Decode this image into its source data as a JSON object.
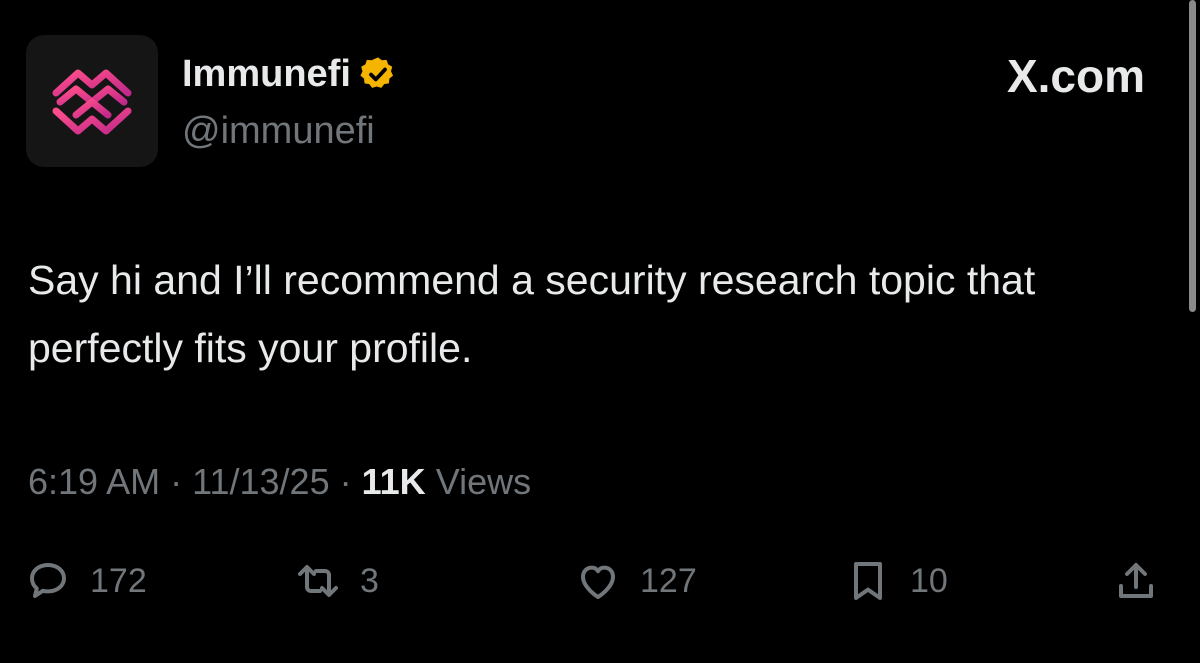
{
  "author": {
    "display_name": "Immunefi",
    "handle": "@immunefi",
    "avatar_icon": "immunefi-logo-icon",
    "verified_icon": "verified-badge-icon",
    "verified_color": "#f4b400"
  },
  "site_label": "X.com",
  "tweet": {
    "text": "Say hi and I’ll recommend a security research topic that perfectly fits your profile."
  },
  "meta": {
    "time": "6:19 AM",
    "separator": "·",
    "date": "11/13/25",
    "views_count": "11K",
    "views_label": "Views"
  },
  "actions": [
    {
      "name": "reply",
      "icon": "reply-icon",
      "count": "172"
    },
    {
      "name": "repost",
      "icon": "repost-icon",
      "count": "3"
    },
    {
      "name": "like",
      "icon": "heart-icon",
      "count": "127"
    },
    {
      "name": "bookmark",
      "icon": "bookmark-icon",
      "count": "10"
    },
    {
      "name": "share",
      "icon": "share-icon",
      "count": ""
    }
  ],
  "colors": {
    "background": "#000000",
    "primary_text": "#e7e9ea",
    "secondary_text": "#71767b",
    "brand_pink": "#e8388a"
  }
}
